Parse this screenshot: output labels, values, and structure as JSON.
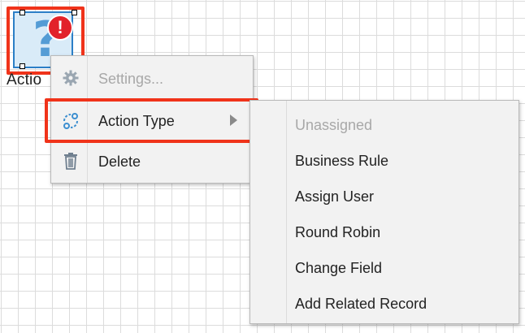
{
  "canvas": {
    "node": {
      "label": "Actio",
      "icon": "question-mark-icon",
      "error_icon": "error-exclamation-icon",
      "error_glyph": "!",
      "question_glyph": "?",
      "selected": true
    }
  },
  "context_menu": {
    "items": [
      {
        "label": "Settings...",
        "icon": "gear-icon",
        "disabled": true
      },
      {
        "label": "Action Type",
        "icon": "action-type-icon",
        "has_submenu": true,
        "highlighted": true
      },
      {
        "label": "Delete",
        "icon": "trash-icon",
        "disabled": false
      }
    ]
  },
  "submenu": {
    "items": [
      {
        "label": "Unassigned",
        "disabled": true
      },
      {
        "label": "Business Rule"
      },
      {
        "label": "Assign User"
      },
      {
        "label": "Round Robin"
      },
      {
        "label": "Change Field"
      },
      {
        "label": "Add Related Record"
      }
    ]
  },
  "colors": {
    "highlight": "#f0331a",
    "node_border": "#2b7fc7",
    "node_fill": "#d9ebf8",
    "error": "#e2222a",
    "menu_bg": "#f2f2f2",
    "disabled_text": "#a8a8a8"
  }
}
